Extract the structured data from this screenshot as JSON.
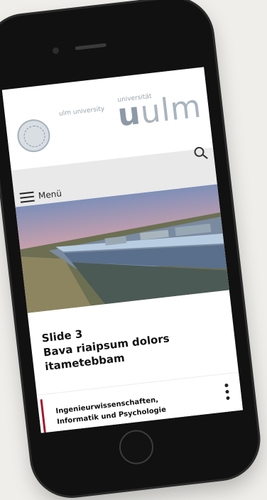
{
  "header": {
    "uni_en": "ulm university",
    "uni_de": "universität",
    "logo_u": "u",
    "logo_ulm": "ulm"
  },
  "toolbar": {
    "menu_label": "Menü"
  },
  "slide": {
    "title_line1": "Slide 3",
    "title_line2": "Bava riaipsum dolors",
    "title_line3": "itametebbam"
  },
  "card": {
    "line1": "Ingenieurwissenschaften,",
    "line2": "Informatik und Psychologie"
  },
  "colors": {
    "accent": "#a3192e",
    "logo": "#aab4bd",
    "toolbar": "#e9e9e9"
  },
  "icons": [
    "search-icon",
    "hamburger-menu-icon",
    "kebab-menu-icon",
    "university-seal-icon"
  ]
}
